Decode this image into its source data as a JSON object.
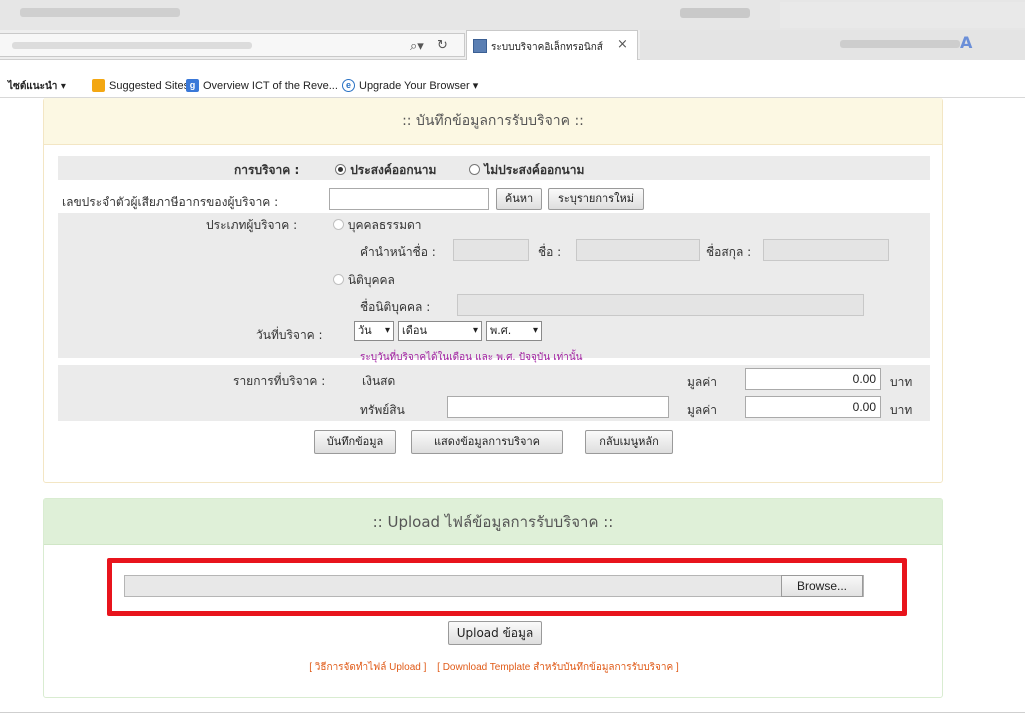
{
  "browser": {
    "tab_title": "ระบบบริจาคอิเล็กทรอนิกส์",
    "favorites": {
      "suggested_menu": "ไซต์แนะนำ ▾",
      "item1": "Suggested Sites",
      "item2": "Overview ICT of the Reve...",
      "item3": "Upgrade Your Browser ▾"
    }
  },
  "donation_panel": {
    "title": ":: บันทึกข้อมูลการรับบริจาค ::",
    "donation_type_label": "การบริจาค :",
    "radio_named": "ประสงค์ออกนาม",
    "radio_anonymous": "ไม่ประสงค์ออกนาม",
    "taxid_label": "เลขประจำตัวผู้เสียภาษีอากรของผู้บริจาค :",
    "search_button": "ค้นหา",
    "new_item_button": "ระบุรายการใหม่",
    "donor_type_label": "ประเภทผู้บริจาค :",
    "person_radio": "บุคคลธรรมดา",
    "prefix_label": "คำนำหน้าชื่อ :",
    "firstname_label": "ชื่อ :",
    "lastname_label": "ชื่อสกุล :",
    "juristic_radio": "นิติบุคคล",
    "juristic_name_label": "ชื่อนิติบุคคล :",
    "date_label": "วันที่บริจาค :",
    "day_select": "วัน",
    "month_select": "เดือน",
    "year_select": "พ.ศ.",
    "date_hint": "ระบุวันที่บริจาคได้ในเดือน และ พ.ศ. ปัจจุบัน เท่านั้น",
    "items_label": "รายการที่บริจาค :",
    "cash_label": "เงินสด",
    "asset_label": "ทรัพย์สิน",
    "value_label": "มูลค่า",
    "cash_value": "0.00",
    "asset_value": "0.00",
    "currency": "บาท",
    "save_button": "บันทึกข้อมูล",
    "show_button": "แสดงข้อมูลการบริจาค",
    "back_button": "กลับเมนูหลัก"
  },
  "upload_panel": {
    "title": ":: Upload ไฟล์ข้อมูลการรับบริจาค ::",
    "browse_button": "Browse...",
    "upload_button": "Upload ข้อมูล",
    "link_howto": "[ วิธีการจัดทำไฟล์ Upload ]",
    "link_template": "[ Download Template สำหรับบันทึกข้อมูลการรับบริจาค ]"
  },
  "colors": {
    "highlight": "#e8141c",
    "hint": "#a020a0",
    "link": "#e05a17"
  }
}
